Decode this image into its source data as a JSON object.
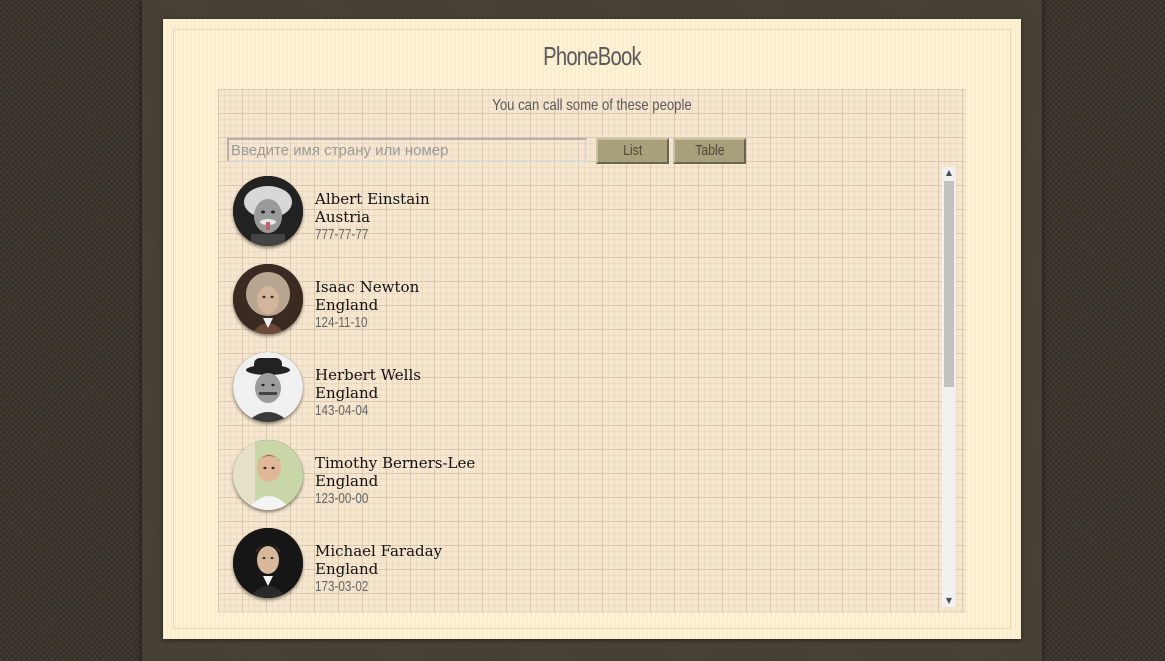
{
  "app": {
    "title": "PhoneBook",
    "subtitle": "You can call some of these people"
  },
  "search": {
    "placeholder": "Введите имя страну или номер"
  },
  "buttons": {
    "list_label": "List",
    "table_label": "Table"
  },
  "contacts": [
    {
      "name": "Albert Einstain",
      "country": "Austria",
      "phone": "777-77-77",
      "avatar_icon": "einstein-portrait"
    },
    {
      "name": "Isaac Newton",
      "country": "England",
      "phone": "124-11-10",
      "avatar_icon": "newton-portrait"
    },
    {
      "name": "Herbert Wells",
      "country": "England",
      "phone": "143-04-04",
      "avatar_icon": "wells-portrait"
    },
    {
      "name": "Timothy Berners-Lee",
      "country": "England",
      "phone": "123-00-00",
      "avatar_icon": "berners-lee-portrait"
    },
    {
      "name": "Michael Faraday",
      "country": "England",
      "phone": "173-03-02",
      "avatar_icon": "faraday-portrait"
    }
  ],
  "scrollbar": {
    "up_icon": "arrow-up-icon",
    "down_icon": "arrow-down-icon"
  }
}
